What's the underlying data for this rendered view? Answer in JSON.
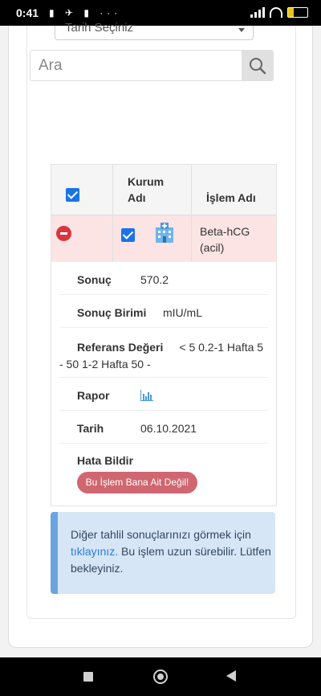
{
  "status_bar": {
    "time": "0:41",
    "battery": "25",
    "notification_icons": "▮ ✈ ▮ ···"
  },
  "filter": {
    "date_select_label": "Tarih Seçiniz"
  },
  "search": {
    "placeholder": "Ara",
    "value": ""
  },
  "table": {
    "headers": {
      "institution": "Kurum Adı",
      "procedure": "İşlem Adı"
    },
    "row": {
      "procedure_name": "Beta-hCG (acil)"
    },
    "details": {
      "result_label": "Sonuç",
      "result_value": "570.2",
      "unit_label": "Sonuç Birimi",
      "unit_value": "mIU/mL",
      "reference_label": "Referans Değeri",
      "reference_value": "< 5 0.2-1 Hafta 5 - 50 1-2 Hafta 50 -",
      "report_label": "Rapor",
      "date_label": "Tarih",
      "date_value": "06.10.2021",
      "report_error_label": "Hata Bildir",
      "report_error_button": "Bu İşlem Bana Ait Değil!"
    }
  },
  "alert": {
    "text_before": "Diğer tahlil sonuçlarınızı görmek için ",
    "link_text": "tıklayınız.",
    "text_after": " Bu işlem uzun sürebilir. Lütfen bekleyiniz."
  },
  "colors": {
    "accent": "#1a73e8",
    "row_highlight": "#fce4e4",
    "danger": "#d9363e",
    "alert_bg": "#d6e6f7"
  }
}
